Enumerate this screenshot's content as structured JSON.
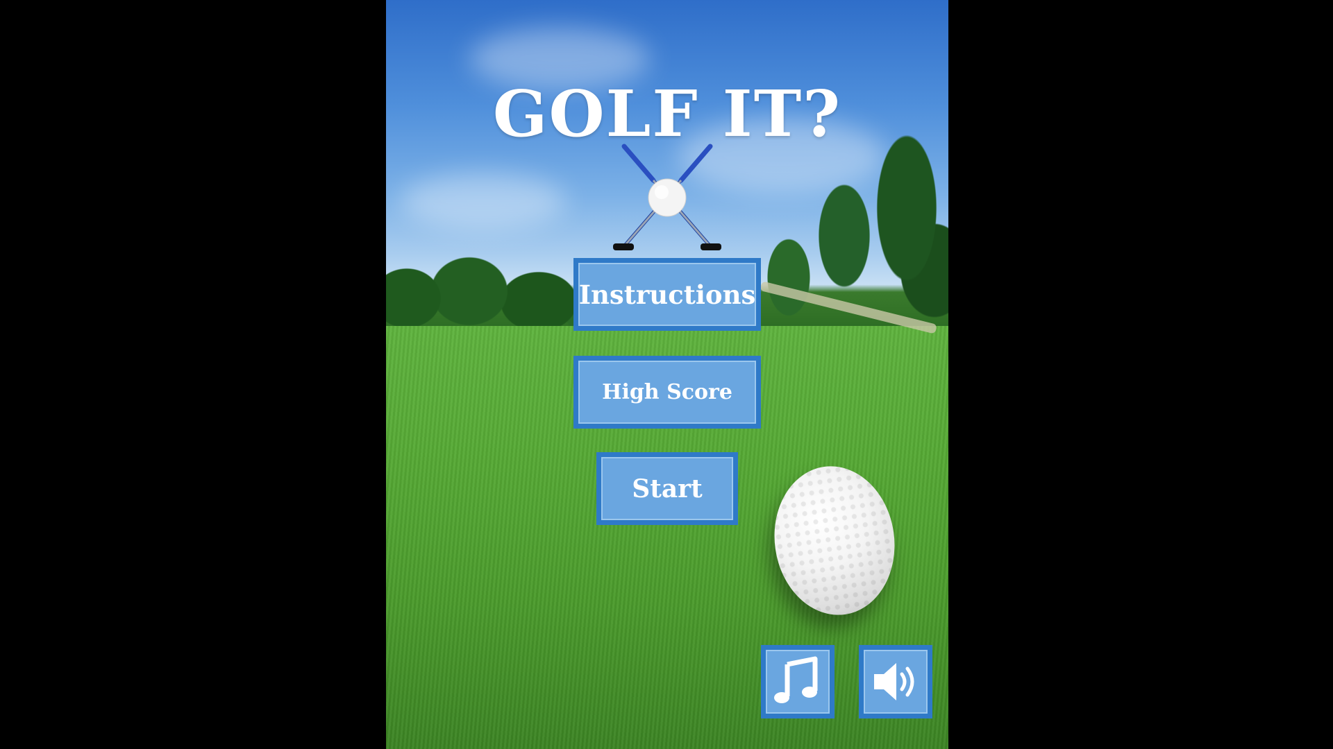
{
  "game": {
    "title": "GOLF IT?"
  },
  "menu": {
    "instructions_label": "Instructions",
    "high_score_label": "High Score",
    "start_label": "Start"
  },
  "controls": {
    "music_icon": "music-note-icon",
    "sound_icon": "speaker-icon"
  },
  "colors": {
    "button_fill": "#6aa6e0",
    "button_border": "#2f7ac8",
    "text": "#ffffff"
  }
}
